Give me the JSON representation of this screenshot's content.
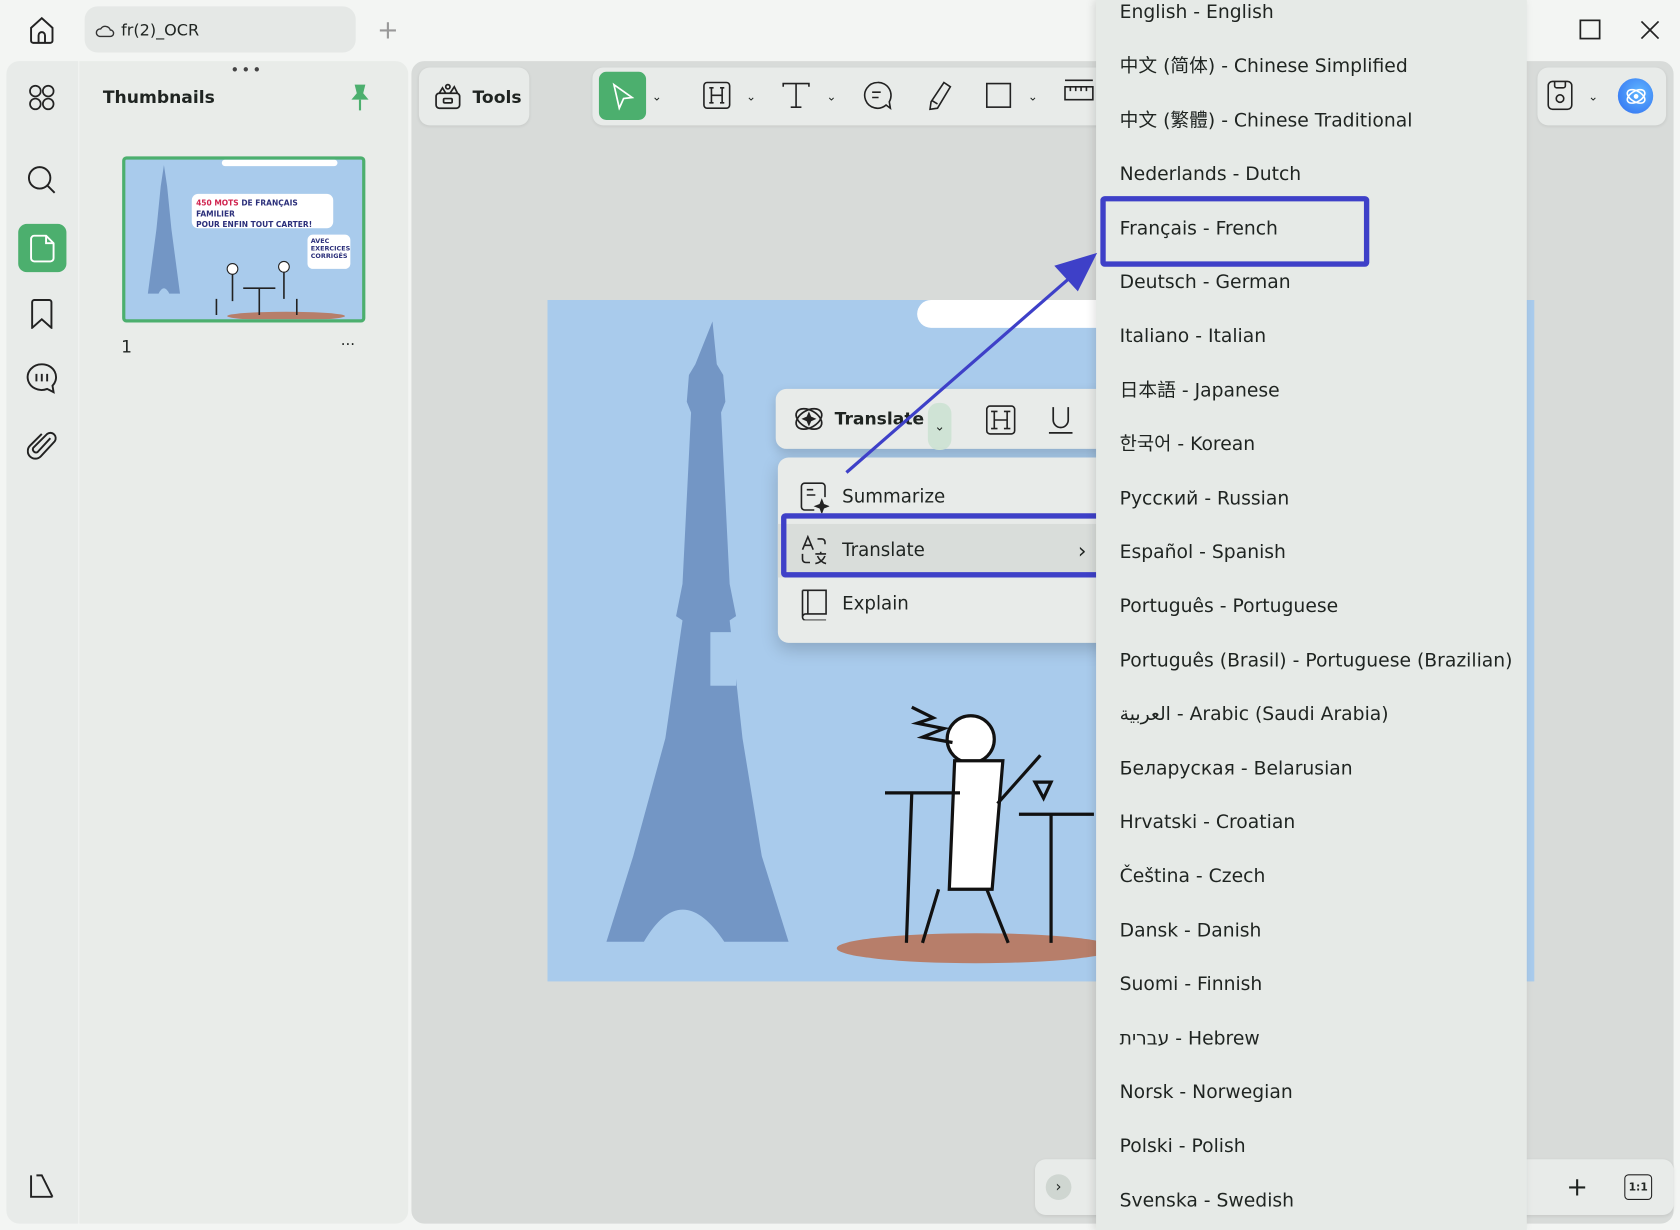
{
  "titlebar": {
    "tab_title": "fr(2)_OCR",
    "new_tab": "+"
  },
  "thumbnails": {
    "title": "Thumbnails",
    "page_number": "1",
    "more": "···",
    "cover_text_red": "450 MOTS",
    "cover_text_1": "DE FRANÇAIS FAMILIER",
    "cover_text_2": "POUR ENFIN TOUT CARTER!",
    "cover_badge_1": "AVEC",
    "cover_badge_2": "EXERCICES",
    "cover_badge_3": "CORRIGÉS"
  },
  "toolbar": {
    "tools_label": "Tools"
  },
  "floating_toolbar": {
    "translate_label": "Translate"
  },
  "context_menu": {
    "items": [
      {
        "label": "Summarize"
      },
      {
        "label": "Translate"
      },
      {
        "label": "Explain"
      }
    ]
  },
  "language_menu": {
    "selected": "Français - French",
    "items": [
      "English - English",
      "中文 (简体) - Chinese Simplified",
      "中文 (繁體) - Chinese Traditional",
      "Nederlands - Dutch",
      "Français - French",
      "Deutsch - German",
      "Italiano - Italian",
      "日本語 - Japanese",
      "한국어 - Korean",
      "Русский - Russian",
      "Español - Spanish",
      "Português - Portuguese",
      "Português (Brasil) - Portuguese (Brazilian)",
      "العربية - Arabic (Saudi Arabia)",
      "Беларуская - Belarusian",
      "Hrvatski - Croatian",
      "Čeština - Czech",
      "Dansk - Danish",
      "Suomi - Finnish",
      "עברית - Hebrew",
      "Norsk - Norwegian",
      "Polski - Polish",
      "Svenska - Swedish"
    ]
  },
  "bottom_bar": {
    "zoom_in": "+",
    "actual_size": "1:1"
  },
  "colors": {
    "accent": "#4caf6e",
    "highlight": "#3e40c8",
    "page_bg": "#a9cbec",
    "tower": "#7396c5"
  }
}
